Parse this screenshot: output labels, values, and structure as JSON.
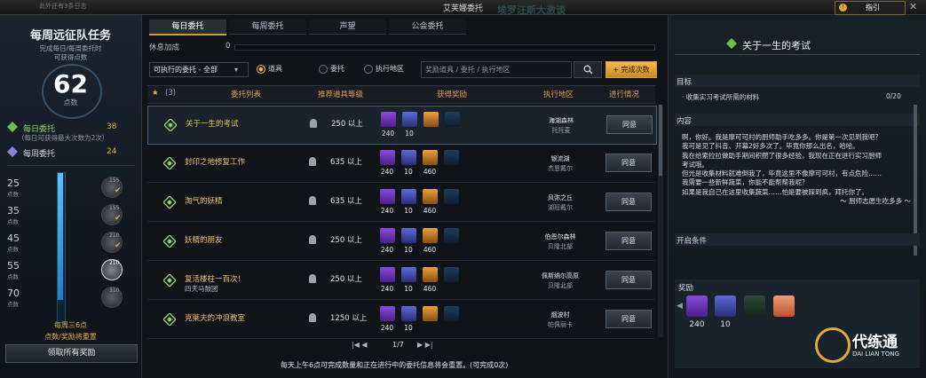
{
  "topbar": {
    "note": "此外还有3条日志",
    "title": "艾芙娜委托",
    "bg_title": "埃罗汪斯大激谈",
    "guide": "指引"
  },
  "left": {
    "title": "每周远征队任务",
    "sub1": "完成每日/每周委托时",
    "sub2": "可获得点数",
    "points": "62",
    "points_label": "点数",
    "daily_label": "每日委托",
    "daily_value": "38",
    "daily_note": "（每日可获得最大次数为2次）",
    "weekly_label": "每周委托",
    "weekly_value": "24",
    "milestones": [
      {
        "n": "25",
        "p": "点数",
        "q": "155"
      },
      {
        "n": "35",
        "p": "点数",
        "q": "155"
      },
      {
        "n": "45",
        "p": "点数",
        "q": "210"
      },
      {
        "n": "55",
        "p": "点数",
        "q": "210"
      },
      {
        "n": "70",
        "p": "点数",
        "q": "310"
      }
    ],
    "progress_fraction": 0.86,
    "reset1": "每周三6点",
    "reset2": "点数/奖励将重置",
    "claim_all": "领取所有奖励"
  },
  "tabs": [
    "每日委托",
    "每周委托",
    "声望",
    "公会委托"
  ],
  "rest": {
    "label": "休息加成",
    "value": "0"
  },
  "filter": {
    "selected": "可执行的委托 - 全部",
    "radios": [
      "道具",
      "委托",
      "执行地区"
    ],
    "search_placeholder": "奖励道具 / 委托 / 执行地区",
    "complete_btn": "+ 完成次数"
  },
  "table": {
    "count": "(3)",
    "headers": [
      "委托列表",
      "推荐道具等级",
      "获得奖励",
      "执行地区",
      "进行情况"
    ],
    "rows": [
      {
        "name": "关于一生的考试",
        "sub": "",
        "level": "250 以上",
        "rewards": [
          "240",
          "10",
          "",
          ""
        ],
        "loc1": "海湖森林",
        "loc2": "托托麦",
        "action": "同意"
      },
      {
        "name": "封印之地修复工作",
        "sub": "",
        "level": "635 以上",
        "rewards": [
          "240",
          "10",
          "460",
          ""
        ],
        "loc1": "银流湖",
        "loc2": "杰恩戴尔",
        "action": "同意"
      },
      {
        "name": "淘气的妖精",
        "sub": "",
        "level": "635 以上",
        "rewards": [
          "240",
          "10",
          "460",
          ""
        ],
        "loc1": "风弥之丘",
        "loc2": "湖班戴尔",
        "action": "同意"
      },
      {
        "name": "妖精的朋友",
        "sub": "",
        "level": "250 以上",
        "rewards": [
          "240",
          "10",
          "460",
          ""
        ],
        "loc1": "伯恩尔森林",
        "loc2": "贝隆北部",
        "action": "同意"
      },
      {
        "name": "复活楼柱一百次！",
        "sub": "四天马鼓团",
        "level": "250 以上",
        "rewards": [
          "240",
          "10",
          "460",
          ""
        ],
        "loc1": "佩斯纳尔高原",
        "loc2": "贝隆北部",
        "action": "同意"
      },
      {
        "name": "克莱夫的冲浪教室",
        "sub": "",
        "level": "1250 以上",
        "rewards": [
          "240",
          "10",
          "",
          ""
        ],
        "loc1": "烟波村",
        "loc2": "帕佩丽卡",
        "action": "同意"
      }
    ]
  },
  "pager": {
    "page": "1/7"
  },
  "bottom_note": "每天上午6点可完成数量和正在进行中的委托信息将会重置。(可完成0次)",
  "right": {
    "title": "关于一生的考试",
    "goal_label": "目标",
    "objective": "· 收集实习考试所需的材料",
    "objective_count": "0/20",
    "content_label": "内容",
    "content": [
      "啊，你好。我是摩可可村的厨师助手吃多多。你是第一次见到我吧？",
      "我可是见了抖音、开幕2好多次了。毕竟你那么出名，哈哈。",
      "我在给索拉拉做助手期间积攒了很多经验，我现在正在进行实习厨师",
      "考试哦。",
      "但光是收集材料就难倒我了，毕竟这里不像摩可可村，有点危险……",
      "我需要一些新鲜蔬菜，你能不能帮帮我呢？",
      "如果是我自己在这里收集蔬菜……怕是要被踩到疯，拜托你了。",
      "～ 厨师志愿生吃多多 ～"
    ],
    "condition_label": "开启条件",
    "reward_label": "奖励",
    "rewards": [
      "240",
      "10",
      "",
      ""
    ]
  },
  "logo": {
    "name": "代练通",
    "sub": "DAI LIAN TONG"
  },
  "colors": {
    "accent": "#e2b04a",
    "button": "#f3b84a",
    "progress": "#52c6ff"
  }
}
